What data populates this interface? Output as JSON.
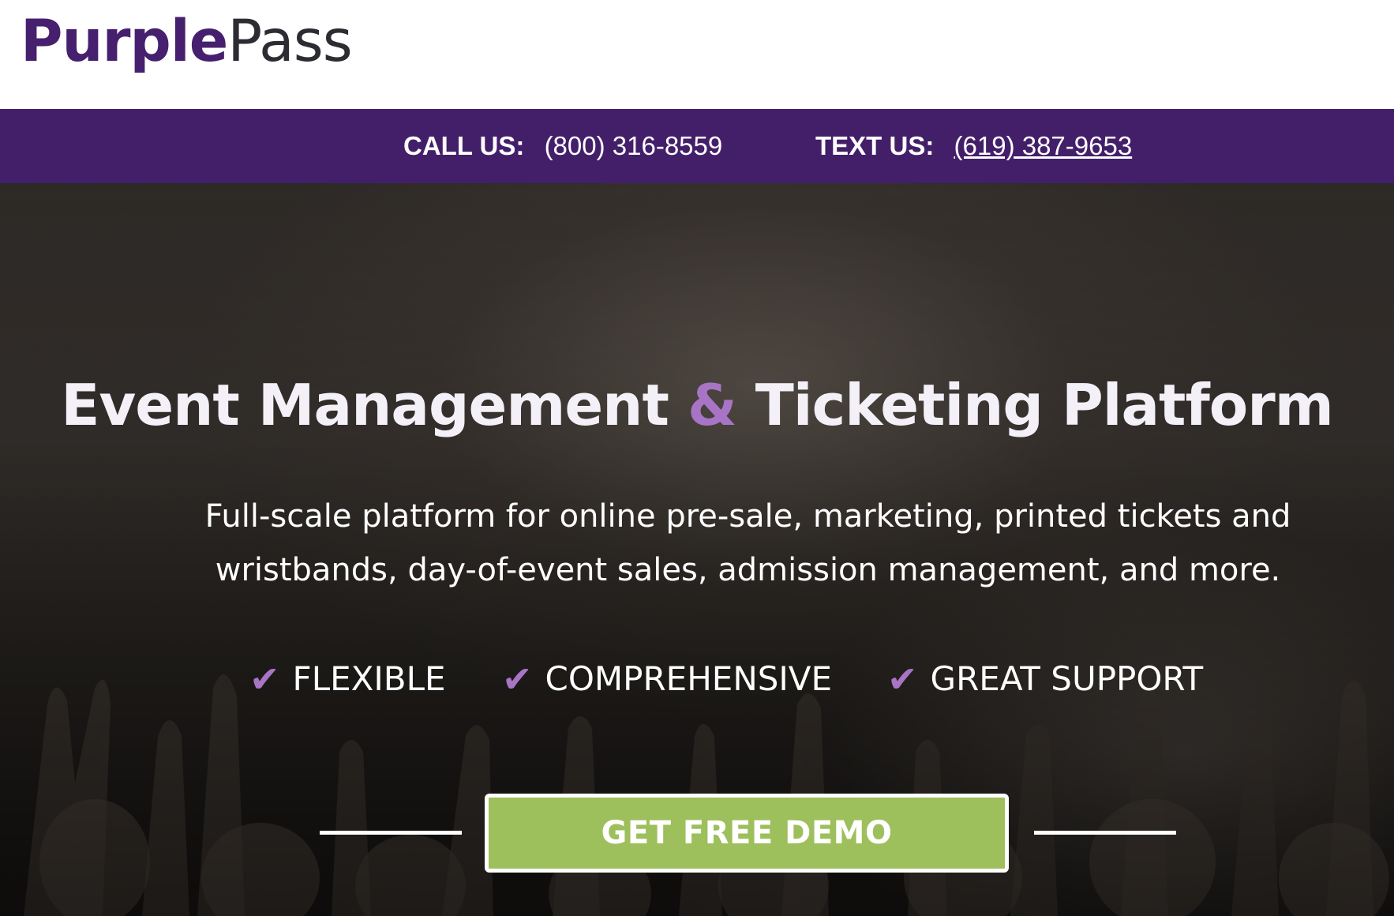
{
  "header": {
    "logo": {
      "part1": "Purple",
      "part2": "Pass"
    }
  },
  "contact_bar": {
    "call_label": "CALL US:",
    "call_number": "(800) 316-8559",
    "text_label": "TEXT US:",
    "text_number": "(619) 387-9653"
  },
  "hero": {
    "title_part1": "Event Management ",
    "title_amp": "&",
    "title_part2": " Ticketing Platform",
    "subtitle": "Full-scale platform for online pre-sale, marketing, printed tickets and wristbands, day-of-event sales, admission management, and more.",
    "features": [
      {
        "icon": "check-icon",
        "label": "FLEXIBLE"
      },
      {
        "icon": "check-icon",
        "label": "COMPREHENSIVE"
      },
      {
        "icon": "check-icon",
        "label": "GREAT SUPPORT"
      }
    ],
    "cta_label": "GET FREE DEMO"
  },
  "colors": {
    "brand_purple": "#431f6a",
    "accent_lavender": "#a874c6",
    "cta_green": "#9dbf5c"
  }
}
